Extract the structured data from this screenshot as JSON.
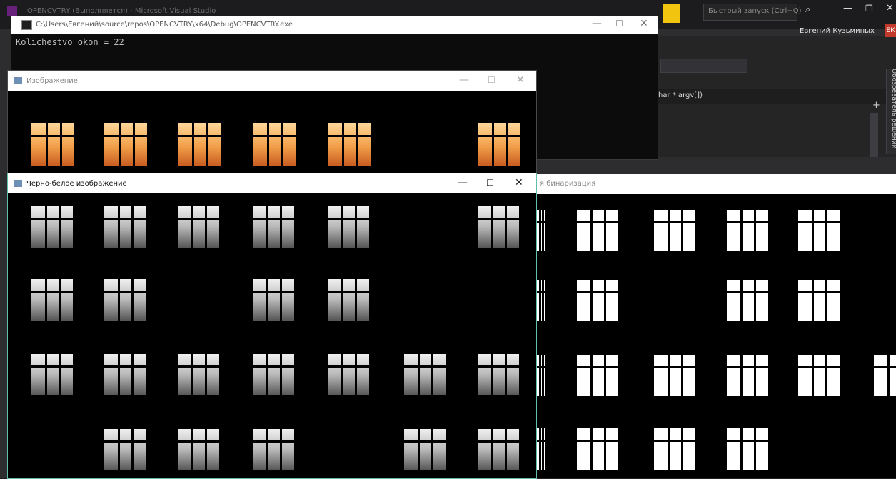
{
  "visual_studio": {
    "title": "OPENCVTRY (Выполняется) - Microsoft Visual Studio",
    "quick_launch_placeholder": "Быстрый запуск (Ctrl+Q)",
    "user_name": "Евгений Кузьминых",
    "user_initials": "ЕК",
    "function_combo": "har * argv[])",
    "solution_explorer_tab": "Обозреватель решений",
    "icons": [
      "filter-icon",
      "search-icon",
      "minimize-icon",
      "restore-icon",
      "close-icon"
    ]
  },
  "console_window": {
    "title": "C:\\Users\\Евгений\\source\\repos\\OPENCVTRY\\x64\\Debug\\OPENCVTRY.exe",
    "output": "Kolichestvo okon = 22",
    "controls": [
      "—",
      "☐",
      "✕"
    ]
  },
  "original_window": {
    "title": "Изображение",
    "controls": [
      "—",
      "☐",
      "✕"
    ]
  },
  "grayscale_window": {
    "title": "Черно-белое изображение",
    "controls": [
      "—",
      "☐",
      "✕"
    ]
  },
  "binarization_window": {
    "title_visible_fragment": "я бинаризация"
  },
  "colors": {
    "window_accent": "#5fbfa8",
    "vs_background": "#2d2d30",
    "vs_filter_icon": "#f1c40f",
    "user_badge": "#c0392b"
  },
  "window_grid": {
    "original_row_lit": [
      true,
      true,
      true,
      true,
      true,
      false,
      true
    ],
    "grayscale_rows": [
      [
        true,
        true,
        true,
        true,
        true,
        false,
        true
      ],
      [
        true,
        true,
        false,
        true,
        true,
        false,
        false
      ],
      [
        true,
        true,
        true,
        true,
        true,
        true,
        true
      ],
      [
        false,
        true,
        true,
        true,
        false,
        true,
        true
      ]
    ],
    "binary_rows": [
      [
        true,
        true,
        true,
        true,
        true,
        false
      ],
      [
        true,
        true,
        false,
        true,
        true,
        false
      ],
      [
        true,
        true,
        true,
        true,
        true,
        true
      ],
      [
        true,
        true,
        true,
        true,
        false,
        false
      ]
    ]
  }
}
